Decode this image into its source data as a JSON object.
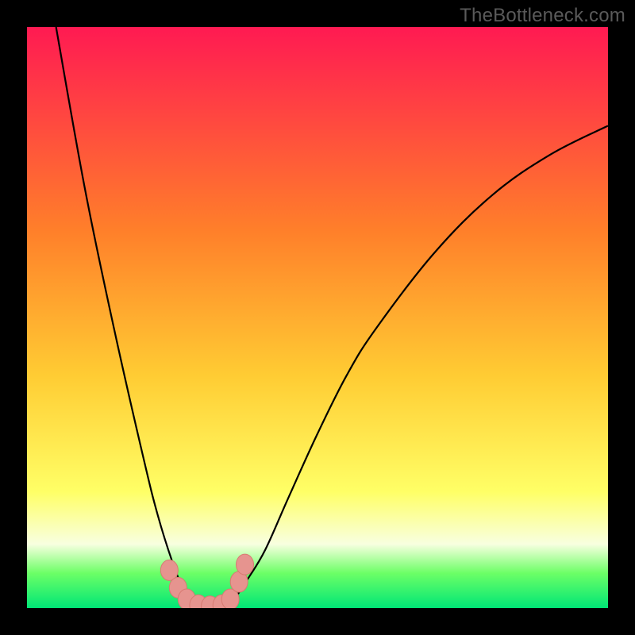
{
  "watermark": {
    "text": "TheBottleneck.com"
  },
  "colors": {
    "bg": "#000000",
    "grad_top": "#ff1a52",
    "grad_mid1": "#ff7f2a",
    "grad_mid2": "#ffcc33",
    "grad_mid3": "#ffff66",
    "grad_band": "#f8ffe0",
    "grad_green1": "#6cff66",
    "grad_green2": "#00e676",
    "curve": "#000000",
    "marker_fill": "#e6948f",
    "marker_stroke": "#d77a72"
  },
  "chart_data": {
    "type": "line",
    "title": "",
    "xlabel": "",
    "ylabel": "",
    "xlim": [
      0,
      100
    ],
    "ylim": [
      0,
      100
    ],
    "note": "No axis ticks or numeric labels are visible; values are normalized estimates.",
    "series": [
      {
        "name": "left-branch",
        "x": [
          5,
          10,
          15,
          20,
          22.5,
          25,
          27,
          28.5,
          30
        ],
        "y": [
          100,
          72,
          48,
          26,
          16,
          8,
          3,
          1,
          0
        ]
      },
      {
        "name": "right-branch",
        "x": [
          34,
          36,
          38,
          41,
          45,
          50,
          55,
          60,
          70,
          80,
          90,
          100
        ],
        "y": [
          0,
          2,
          5,
          10,
          19,
          30,
          40,
          48,
          61,
          71,
          78,
          83
        ]
      }
    ],
    "markers": [
      {
        "x": 24.5,
        "y": 6.5
      },
      {
        "x": 26.0,
        "y": 3.5
      },
      {
        "x": 27.5,
        "y": 1.5
      },
      {
        "x": 29.5,
        "y": 0.5
      },
      {
        "x": 31.5,
        "y": 0.3
      },
      {
        "x": 33.5,
        "y": 0.5
      },
      {
        "x": 35.0,
        "y": 1.5
      },
      {
        "x": 36.5,
        "y": 4.5
      },
      {
        "x": 37.5,
        "y": 7.5
      }
    ],
    "gradient_stops": [
      {
        "pct": 0,
        "color": "#ff1a52"
      },
      {
        "pct": 35,
        "color": "#ff7f2a"
      },
      {
        "pct": 60,
        "color": "#ffcc33"
      },
      {
        "pct": 80,
        "color": "#ffff66"
      },
      {
        "pct": 89,
        "color": "#f8ffe0"
      },
      {
        "pct": 94,
        "color": "#6cff66"
      },
      {
        "pct": 100,
        "color": "#00e676"
      }
    ]
  }
}
